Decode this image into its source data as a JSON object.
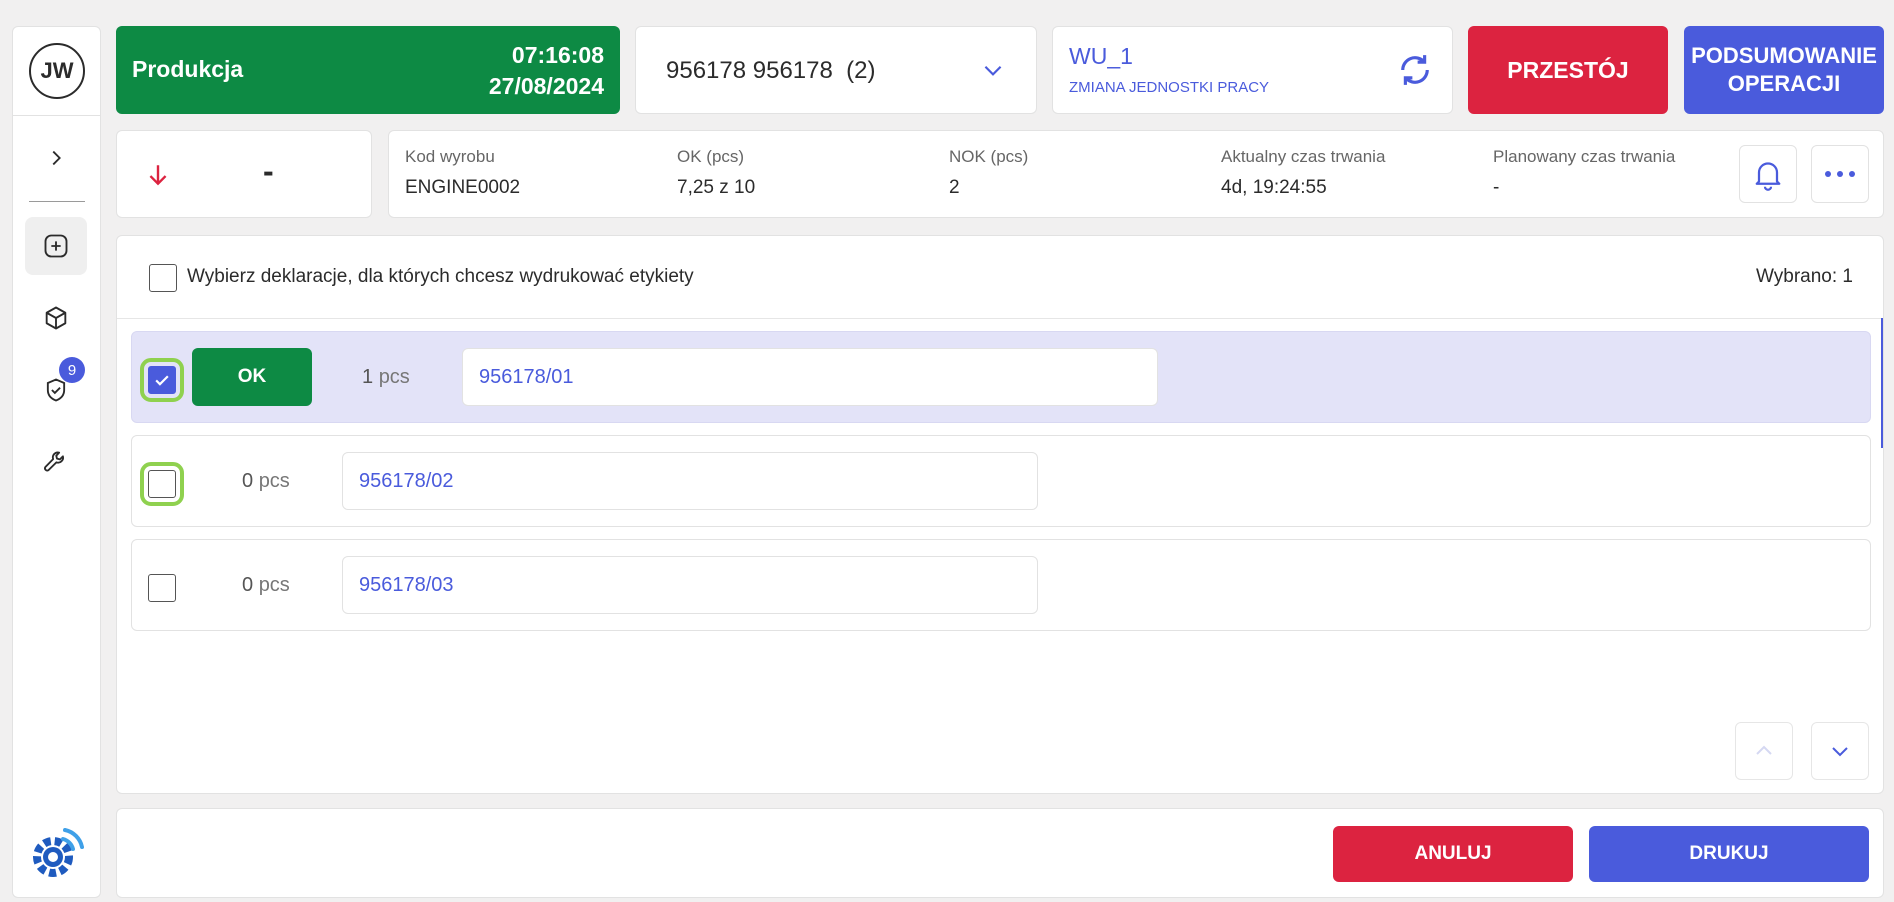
{
  "user": {
    "initials": "JW"
  },
  "sidebar": {
    "items": [
      {
        "icon": "chevron-right-icon"
      },
      {
        "icon": "plus-square-icon",
        "active": true
      },
      {
        "icon": "cube-icon"
      },
      {
        "icon": "shield-check-icon",
        "badge": "9"
      },
      {
        "icon": "wrench-icon"
      }
    ],
    "logo": "gear-wifi-logo"
  },
  "status": {
    "label": "Produkcja",
    "time": "07:16:08",
    "date": "27/08/2024",
    "color": "#0d8a44"
  },
  "order": {
    "value": "956178 956178  (2)"
  },
  "work_unit": {
    "title": "WU_1",
    "subtitle": "ZMIANA JEDNOSTKI PRACY"
  },
  "actions": {
    "downtime": "PRZESTÓJ",
    "summary": "PODSUMOWANIE OPERACJI"
  },
  "trend": {
    "value": "-"
  },
  "info": [
    {
      "label": "Kod wyrobu",
      "value": "ENGINE0002"
    },
    {
      "label": "OK (pcs)",
      "value": "7,25 z 10"
    },
    {
      "label": "NOK (pcs)",
      "value": "2"
    },
    {
      "label": "Aktualny czas trwania",
      "value": "4d, 19:24:55"
    },
    {
      "label": "Planowany czas trwania",
      "value": "-"
    }
  ],
  "labels_panel": {
    "header_text": "Wybierz deklaracje, dla których chcesz wydrukować etykiety",
    "selected_count": "Wybrano: 1",
    "rows": [
      {
        "checked": true,
        "status": "OK",
        "qty": "1",
        "unit": "pcs",
        "lot": "956178/01"
      },
      {
        "checked": false,
        "status": "",
        "qty": "0",
        "unit": "pcs",
        "lot": "956178/02"
      },
      {
        "checked": false,
        "status": "",
        "qty": "0",
        "unit": "pcs",
        "lot": "956178/03"
      }
    ]
  },
  "footer": {
    "cancel": "ANULUJ",
    "print": "DRUKUJ"
  },
  "colors": {
    "accent": "#4a5bdc",
    "danger": "#dc2340",
    "success": "#0d8a44"
  }
}
